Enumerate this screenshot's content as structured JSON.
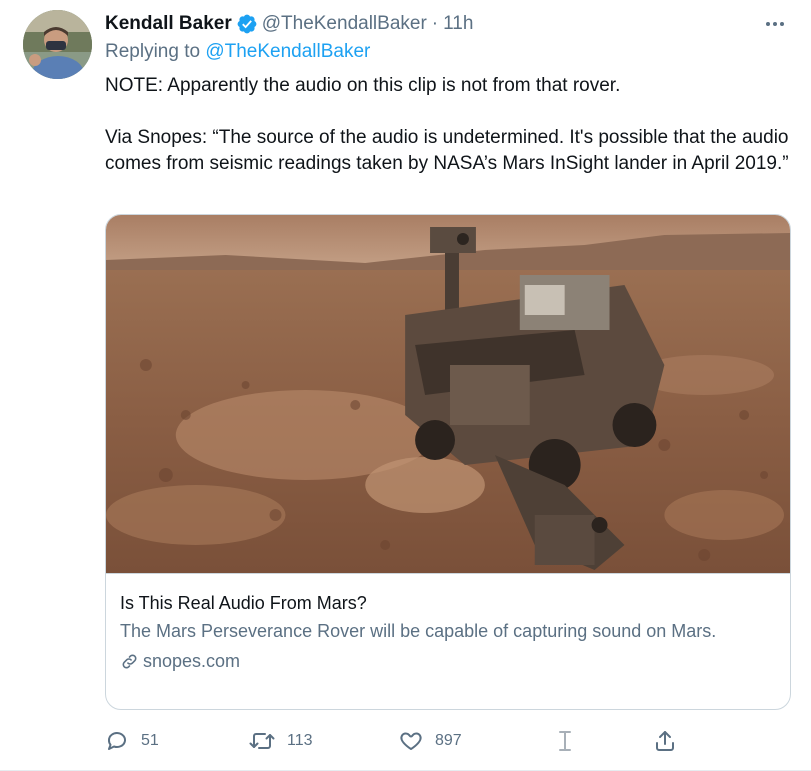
{
  "tweet": {
    "author_name": "Kendall Baker",
    "author_handle": "@TheKendallBaker",
    "separator": "·",
    "time": "11h",
    "replying_prefix": "Replying to",
    "replying_to": "@TheKendallBaker",
    "text_paragraph_1": "NOTE: Apparently the audio on this clip is not from that rover.",
    "text_paragraph_2": "Via Snopes: “The source of the audio is undetermined. It's possible that the audio comes from seismic readings taken by NASA’s Mars InSight lander in April 2019.”"
  },
  "card": {
    "title": "Is This Real Audio From Mars?",
    "description": "The Mars Perseverance Rover will be capable of capturing sound on Mars.",
    "domain": "snopes.com"
  },
  "actions": {
    "reply_count": "51",
    "retweet_count": "113",
    "like_count": "897"
  },
  "colors": {
    "accent": "#1da1f2",
    "secondary_text": "#5b7083",
    "primary_text": "#0f1419",
    "border": "#ccd6dd"
  },
  "icons": {
    "verified": "verified-badge-icon",
    "more": "more-horizontal-icon",
    "link": "link-icon",
    "reply": "reply-icon",
    "retweet": "retweet-icon",
    "like": "heart-icon",
    "extension": "text-cursor-icon",
    "share": "share-icon"
  }
}
